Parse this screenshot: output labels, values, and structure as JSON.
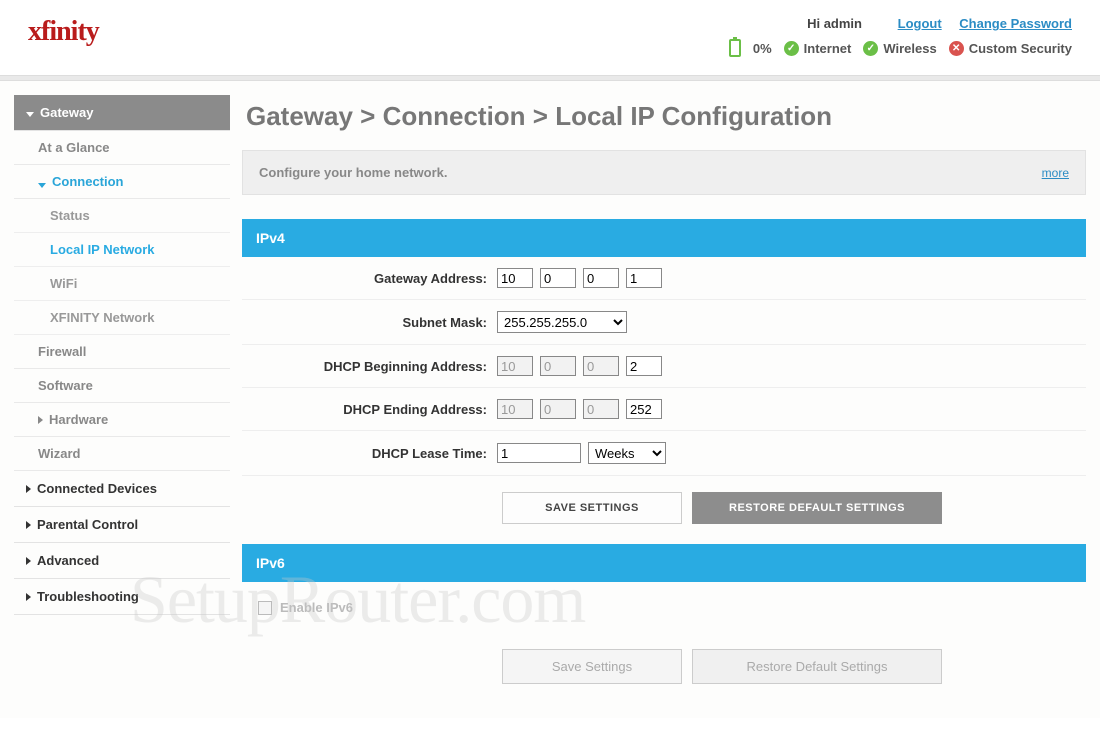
{
  "header": {
    "logo": "xfinity",
    "greeting": "Hi admin",
    "logout": "Logout",
    "changePwd": "Change Password",
    "batteryPct": "0%",
    "status": {
      "internet": "Internet",
      "wireless": "Wireless",
      "security": "Custom Security"
    }
  },
  "sidebar": {
    "gateway": "Gateway",
    "atAGlance": "At a Glance",
    "connection": "Connection",
    "status": "Status",
    "localIp": "Local IP Network",
    "wifi": "WiFi",
    "xfinityNet": "XFINITY Network",
    "firewall": "Firewall",
    "software": "Software",
    "hardware": "Hardware",
    "wizard": "Wizard",
    "connectedDevices": "Connected Devices",
    "parentalControl": "Parental Control",
    "advanced": "Advanced",
    "troubleshooting": "Troubleshooting"
  },
  "breadcrumb": "Gateway > Connection > Local IP Configuration",
  "intro": {
    "text": "Configure your home network.",
    "more": "more"
  },
  "ipv4": {
    "title": "IPv4",
    "labels": {
      "gateway": "Gateway Address:",
      "subnet": "Subnet Mask:",
      "dhcpBegin": "DHCP Beginning Address:",
      "dhcpEnd": "DHCP Ending Address:",
      "lease": "DHCP Lease Time:"
    },
    "gateway": [
      "10",
      "0",
      "0",
      "1"
    ],
    "subnet": "255.255.255.0",
    "dhcpBegin": [
      "10",
      "0",
      "0",
      "2"
    ],
    "dhcpEnd": [
      "10",
      "0",
      "0",
      "252"
    ],
    "leaseVal": "1",
    "leaseUnit": "Weeks",
    "saveBtn": "SAVE SETTINGS",
    "restoreBtn": "RESTORE DEFAULT SETTINGS"
  },
  "ipv6": {
    "title": "IPv6",
    "enable": "Enable IPv6",
    "saveBtn": "Save Settings",
    "restoreBtn": "Restore Default Settings"
  },
  "watermark": "SetupRouter.com"
}
